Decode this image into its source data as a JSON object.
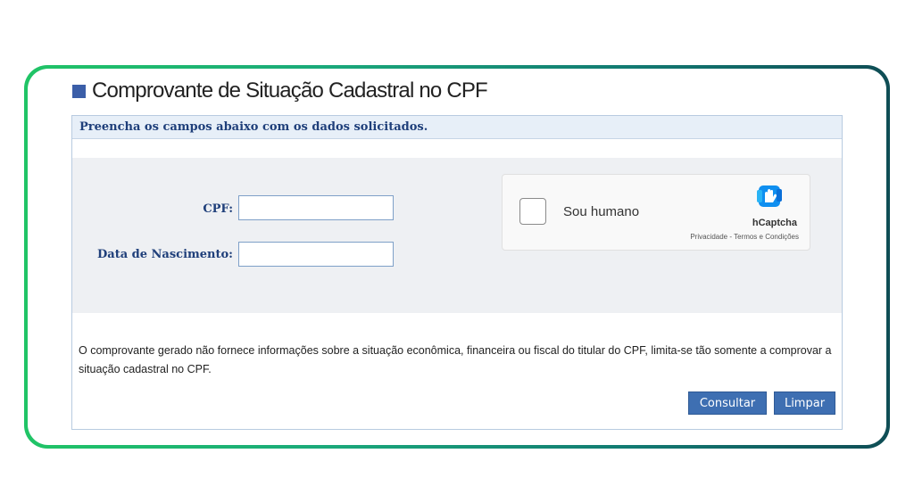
{
  "page": {
    "title": "Comprovante de Situação Cadastral no CPF",
    "instruction": "Preencha os campos abaixo com os dados solicitados."
  },
  "form": {
    "cpf_label": "CPF:",
    "cpf_value": "",
    "birth_label": "Data de Nascimento:",
    "birth_value": ""
  },
  "captcha": {
    "checkbox_label": "Sou humano",
    "brand": "hCaptcha",
    "links": "Privacidade - Termos e Condições",
    "logo_icon": "hcaptcha-hand-icon"
  },
  "disclaimer": "O comprovante gerado não fornece informações sobre a situação econômica, financeira ou fiscal do titular do CPF, limita-se tão somente a comprovar a situação cadastral no CPF.",
  "buttons": {
    "consultar": "Consultar",
    "limpar": "Limpar"
  },
  "colors": {
    "accent": "#3e6fb2",
    "label_blue": "#1f3f7a",
    "frame_start": "#20c466",
    "frame_end": "#0f4d55"
  }
}
